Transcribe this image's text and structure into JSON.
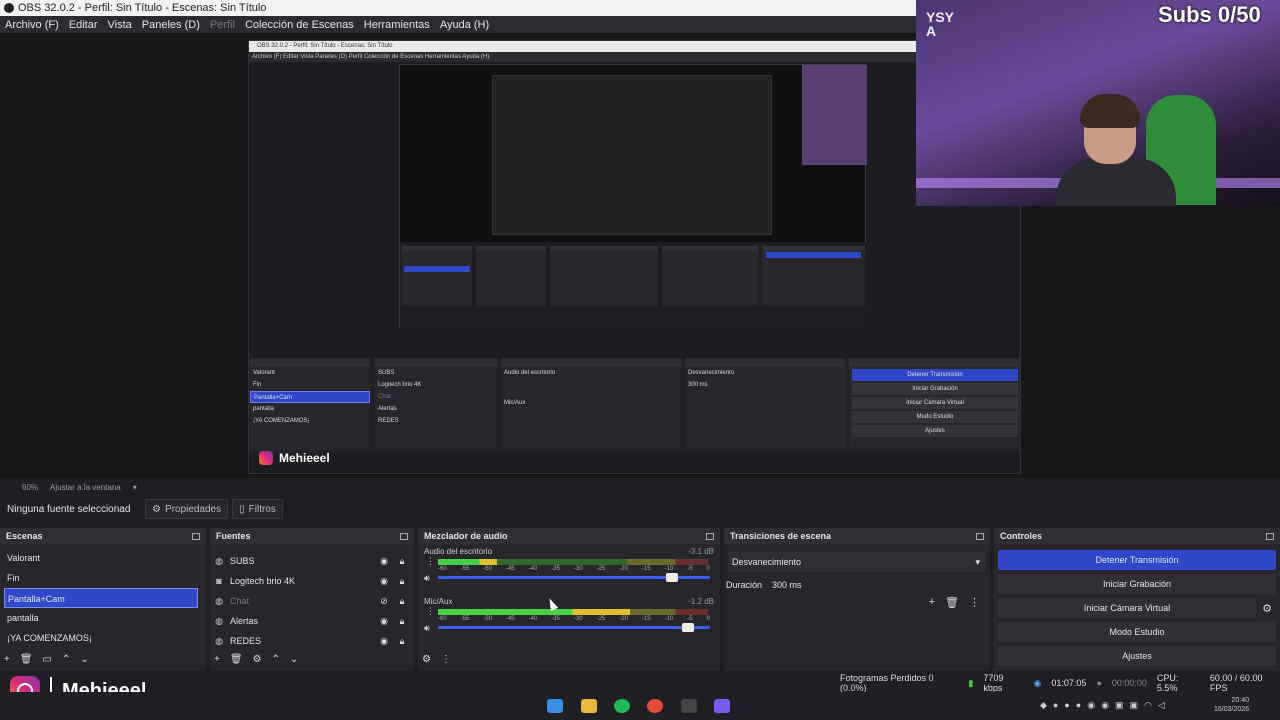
{
  "window": {
    "title": "OBS 32.0.2 - Perfil: Sin Título - Escenas: Sin Título"
  },
  "menu": {
    "items": [
      "Archivo (F)",
      "Editar",
      "Vista",
      "Paneles (D)",
      "Perfil",
      "Colección de Escenas",
      "Herramientas",
      "Ayuda (H)"
    ]
  },
  "overlay": {
    "subs_counter": "Subs 0/50",
    "instagram_handle": "Mehieeel",
    "poster_text": "YSY A"
  },
  "capture": {
    "title": "OBS 32.0.2 - Perfil: Sin Título - Escenas: Sin Título",
    "menu": "Archivo (F)  Editar  Vista  Paneles (D)  Perfil  Colección de Escenas  Herramientas  Ayuda (H)"
  },
  "zoom": {
    "level": "60%",
    "fit_label": "Ajustar a la ventana"
  },
  "properties_bar": {
    "no_selection": "Ninguna fuente seleccionad",
    "properties_label": "Propiedades",
    "filters_label": "Filtros"
  },
  "scenes": {
    "header": "Escenas",
    "items": [
      {
        "label": "Valorant"
      },
      {
        "label": "Fin"
      },
      {
        "label": "Pantalla+Cam",
        "selected": true
      },
      {
        "label": "pantalla"
      },
      {
        "label": "¡YA COMENZAMOS¡"
      }
    ]
  },
  "sources": {
    "header": "Fuentes",
    "items": [
      {
        "label": "SUBS",
        "icon": "globe-icon",
        "visible": true
      },
      {
        "label": "Logitech brio 4K",
        "icon": "camera-icon",
        "visible": true
      },
      {
        "label": "Chat",
        "icon": "globe-icon",
        "visible": false
      },
      {
        "label": "Alertas",
        "icon": "globe-icon",
        "visible": true
      },
      {
        "label": "REDES",
        "icon": "globe-icon",
        "visible": true
      }
    ]
  },
  "mixer": {
    "header": "Mezclador de audio",
    "channels": [
      {
        "name": "Audio del escritorio",
        "db": "-3.1 dB",
        "level": 0.22,
        "volume": 0.86
      },
      {
        "name": "Mic/Aux",
        "db": "-1.2 dB",
        "level": 0.71,
        "volume": 0.92
      }
    ],
    "ticks": [
      "-60",
      "-55",
      "-50",
      "-45",
      "-40",
      "-35",
      "-30",
      "-25",
      "-20",
      "-15",
      "-10",
      "-5",
      "0"
    ]
  },
  "transitions": {
    "header": "Transiciones de escena",
    "selected": "Desvanecimiento",
    "duration_label": "Duración",
    "duration_value": "300 ms"
  },
  "controls": {
    "header": "Controles",
    "stop_stream": "Detener Transmisión",
    "start_recording": "Iniciar Grabación",
    "start_virtual_cam": "Iniciar Cámara Virtual",
    "studio_mode": "Modo Estudio",
    "settings": "Ajustes"
  },
  "status": {
    "dropped_frames": "Fotogramas Perdidos 0 (0.0%)",
    "bitrate": "7709 kbps",
    "stream_time": "01:07:05",
    "record_time": "00:00:00",
    "cpu": "CPU: 5.5%",
    "fps": "60.00 / 60.00 FPS"
  },
  "clock": {
    "time": "20:40",
    "date": "16/03/2026"
  },
  "colors": {
    "accent": "#2f47c8",
    "panel": "#26262b",
    "background": "#1f1f23"
  }
}
